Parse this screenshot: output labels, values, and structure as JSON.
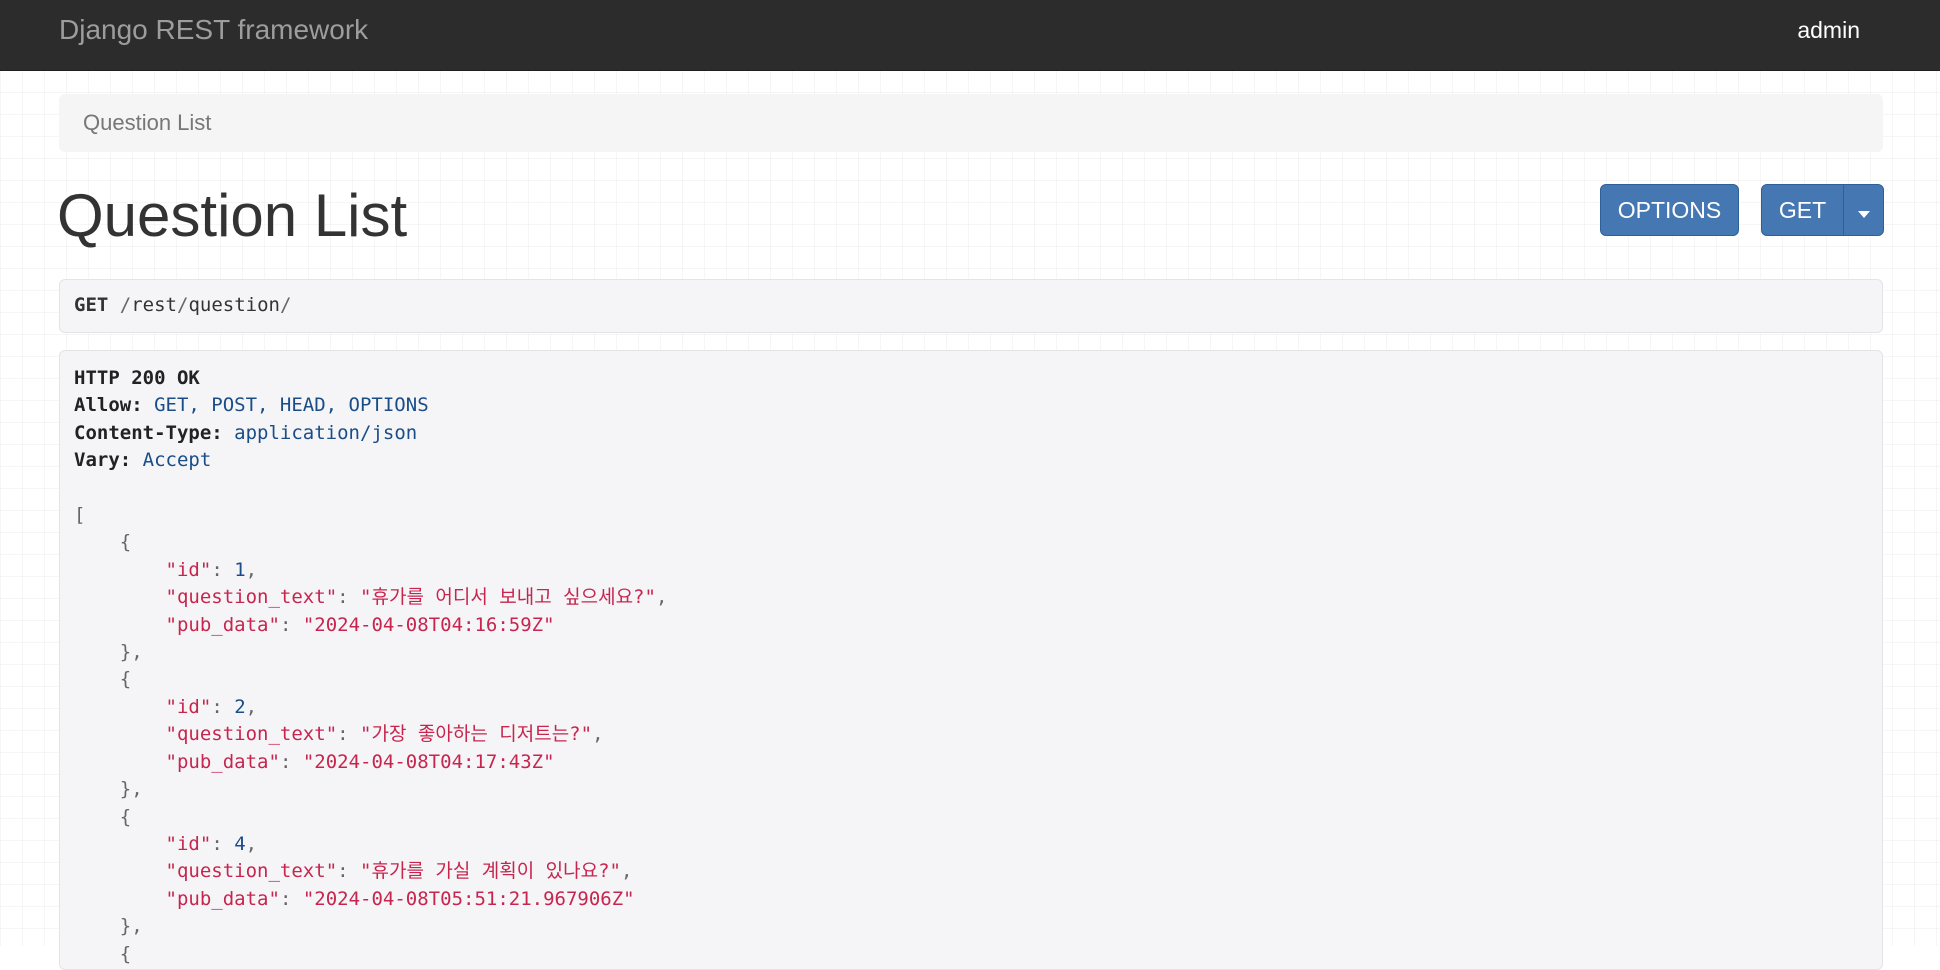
{
  "navbar": {
    "brand": "Django REST framework",
    "user": "admin"
  },
  "breadcrumb": {
    "items": [
      "Question List"
    ]
  },
  "page": {
    "title": "Question List"
  },
  "buttons": {
    "options_label": "OPTIONS",
    "get_label": "GET"
  },
  "request": {
    "method": "GET",
    "path_parts": [
      "rest",
      "question"
    ]
  },
  "response": {
    "status": "HTTP 200 OK",
    "headers": [
      {
        "name": "Allow:",
        "value": "GET, POST, HEAD, OPTIONS"
      },
      {
        "name": "Content-Type:",
        "value": "application/json"
      },
      {
        "name": "Vary:",
        "value": "Accept"
      }
    ],
    "items": [
      {
        "id": 1,
        "question_text": "휴가를 어디서 보내고 싶으세요?",
        "pub_data": "2024-04-08T04:16:59Z"
      },
      {
        "id": 2,
        "question_text": "가장 좋아하는 디저트는?",
        "pub_data": "2024-04-08T04:17:43Z"
      },
      {
        "id": 4,
        "question_text": "휴가를 가실 계획이 있나요?",
        "pub_data": "2024-04-08T05:51:21.967906Z"
      }
    ],
    "field_keys": [
      "id",
      "question_text",
      "pub_data"
    ]
  },
  "colors": {
    "navbar_bg": "#2c2c2c",
    "button_primary": "#4577b3",
    "json_string": "#c7254e",
    "json_literal": "#1a4d88"
  },
  "icons": {
    "dropdown": "caret-down-icon"
  }
}
